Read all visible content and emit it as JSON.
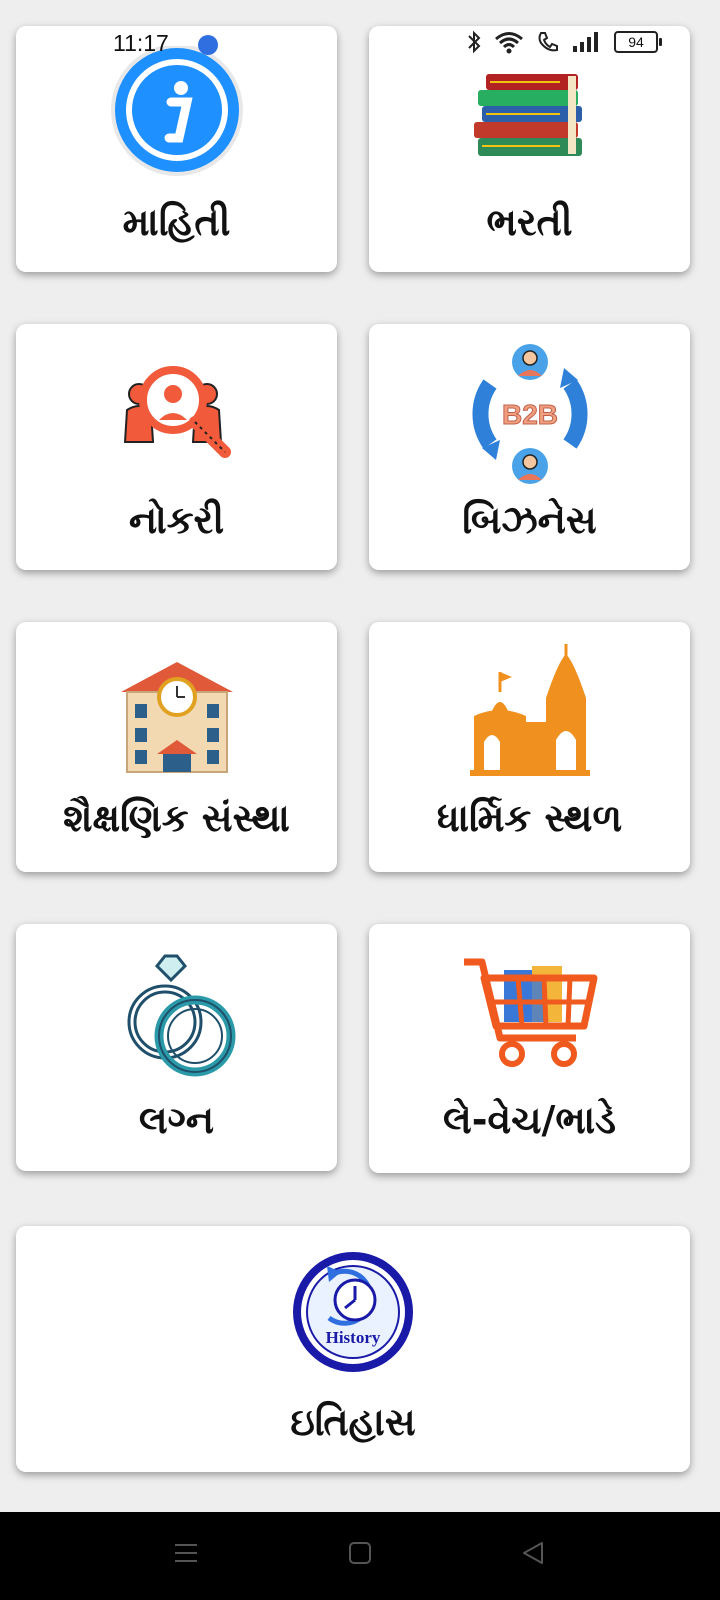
{
  "status": {
    "time": "11:17",
    "battery": "94"
  },
  "tiles": [
    {
      "label": "માહિતી",
      "icon": "info-icon"
    },
    {
      "label": "ભરતી",
      "icon": "books-icon"
    },
    {
      "label": "નોકરી",
      "icon": "job-search-icon"
    },
    {
      "label": "બિઝનેસ",
      "icon": "b2b-icon"
    },
    {
      "label": "શૈક્ષણિક સંસ્થા",
      "icon": "school-building-icon"
    },
    {
      "label": "ધાર્મિક સ્થળ",
      "icon": "temple-icon"
    },
    {
      "label": "લગ્ન",
      "icon": "rings-icon"
    },
    {
      "label": "લે-વેચ/ભાડે",
      "icon": "shopping-cart-icon"
    },
    {
      "label": "ઇતિહાસ",
      "icon": "history-icon"
    }
  ],
  "history_icon_text": "History",
  "b2b_icon_text": "B2B",
  "colors": {
    "accent_blue": "#1e90ff",
    "temple_orange": "#f0901e",
    "cart_orange": "#f05a1e"
  }
}
